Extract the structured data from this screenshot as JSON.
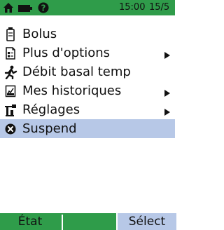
{
  "status_bar": {
    "icons": [
      "home-icon",
      "battery-icon",
      "alert-icon"
    ],
    "time": "15:00",
    "date": "15/5",
    "background": "#2f9c4a"
  },
  "menu": {
    "items": [
      {
        "label": "Bolus",
        "icon": "bolus-icon",
        "has_submenu": false
      },
      {
        "label": "Plus d'options",
        "icon": "options-icon",
        "has_submenu": true
      },
      {
        "label": "Débit basal temp",
        "icon": "temp-basal-icon",
        "has_submenu": false
      },
      {
        "label": "Mes historiques",
        "icon": "history-icon",
        "has_submenu": true
      },
      {
        "label": "Réglages",
        "icon": "settings-icon",
        "has_submenu": true
      },
      {
        "label": "Suspend",
        "icon": "suspend-icon",
        "has_submenu": false,
        "selected": true
      }
    ],
    "selected_color": "#b7c8e7"
  },
  "softkeys": {
    "left_label": "État",
    "right_label": "Sélect"
  }
}
